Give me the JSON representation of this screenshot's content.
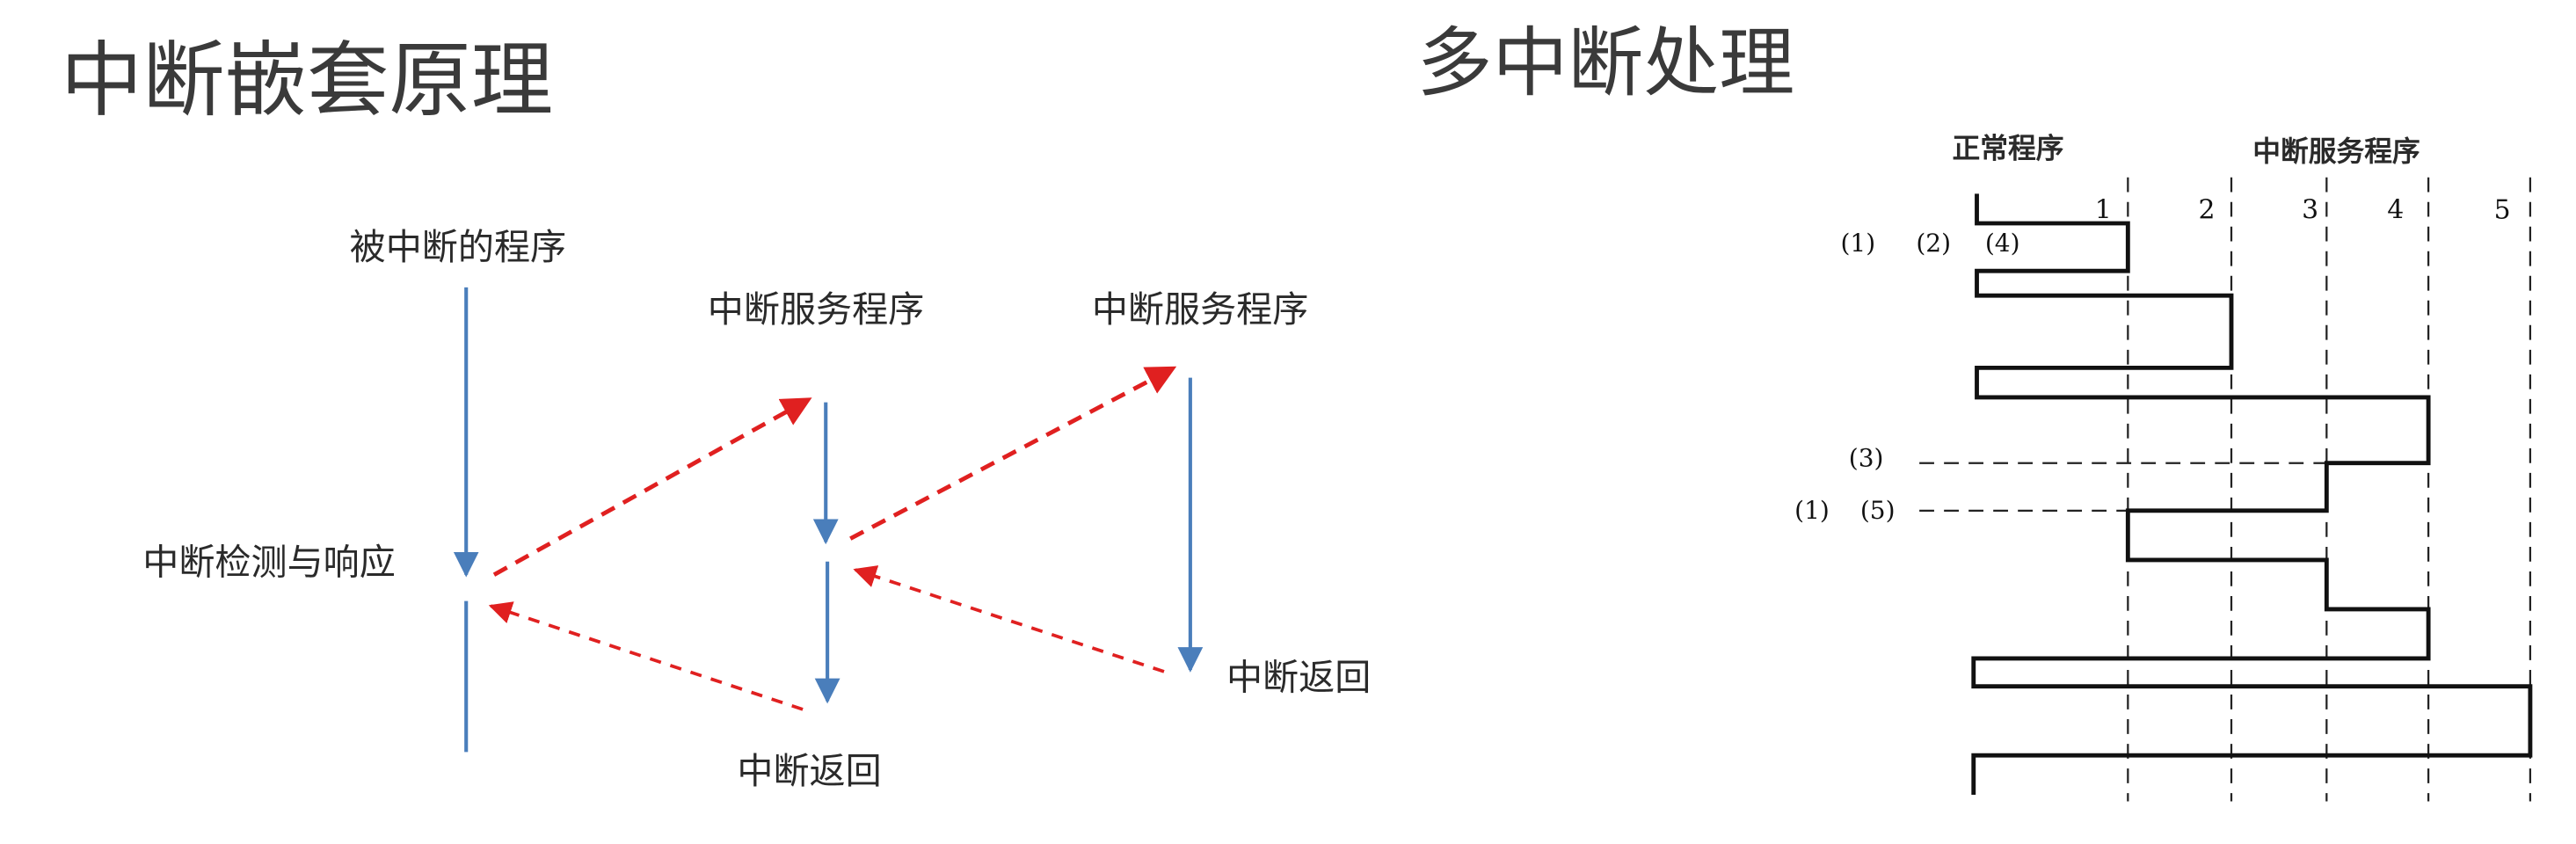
{
  "titles": {
    "left": "中断嵌套原理",
    "right": "多中断处理"
  },
  "nesting": {
    "interrupted_program": "被中断的程序",
    "detect_respond": "中断检测与响应",
    "isr_1": "中断服务程序",
    "isr_2": "中断服务程序",
    "return_1": "中断返回",
    "return_2": "中断返回",
    "colors": {
      "flow": "#4a7ebb",
      "call": "#e02020"
    }
  },
  "multi": {
    "normal_program": "正常程序",
    "isr": "中断服务程序",
    "levels": [
      "1",
      "2",
      "3",
      "4",
      "5"
    ],
    "labels": {
      "a": "(1)",
      "b": "(2)",
      "c": "(4)",
      "d": "(3)",
      "e": "(1)",
      "f": "(5)"
    }
  }
}
